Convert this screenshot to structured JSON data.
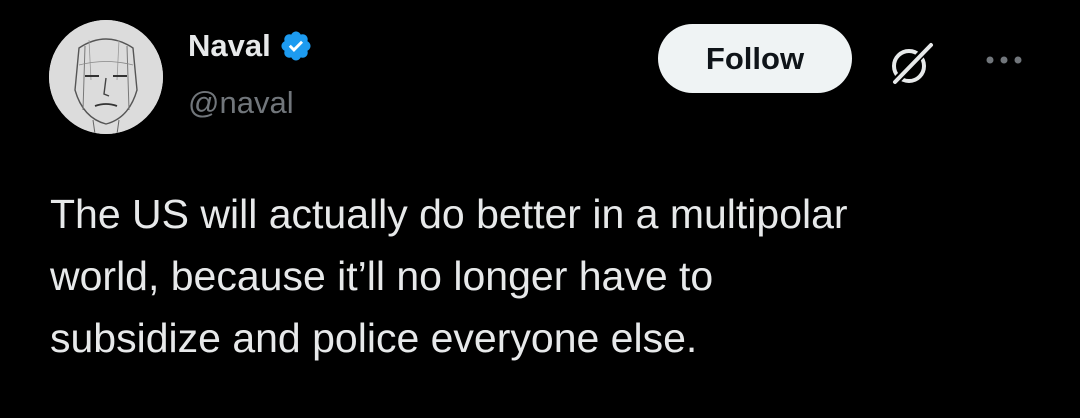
{
  "tweet": {
    "author": {
      "display_name": "Naval",
      "handle": "@naval",
      "verified": true,
      "avatar_icon": "sketch-portrait-avatar"
    },
    "follow_label": "Follow",
    "grok_icon": "grok-icon",
    "more_icon": "more-options-icon",
    "text": "The US will actually do better in a multipolar\nworld, because it’ll no longer have to\nsubsidize and police everyone else."
  },
  "colors": {
    "background": "#000000",
    "primary_text": "#e7e9ea",
    "secondary_text": "#71767b",
    "verified_blue": "#1d9bf0",
    "follow_button_bg": "#eff3f4",
    "follow_button_text": "#0f1419"
  }
}
